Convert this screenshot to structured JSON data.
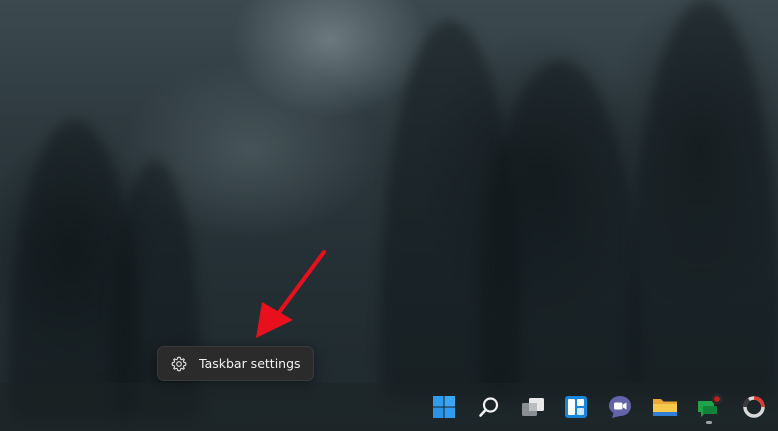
{
  "context_menu": {
    "items": [
      {
        "label": "Taskbar settings",
        "icon": "gear-icon"
      }
    ]
  },
  "taskbar": {
    "icons": [
      {
        "name": "start-button",
        "icon": "windows-logo-icon"
      },
      {
        "name": "search-button",
        "icon": "search-icon"
      },
      {
        "name": "task-view-button",
        "icon": "task-view-icon"
      },
      {
        "name": "widgets-button",
        "icon": "widgets-icon"
      },
      {
        "name": "teams-chat-button",
        "icon": "teams-chat-icon"
      },
      {
        "name": "file-explorer-button",
        "icon": "folder-icon"
      },
      {
        "name": "greenshot-app-button",
        "icon": "greenshot-icon",
        "running": true
      },
      {
        "name": "app-button",
        "icon": "ring-app-icon"
      }
    ]
  },
  "colors": {
    "arrow": "#e8101c",
    "menu_bg": "#2b2b2b",
    "windows_blue": "#2f9cf0",
    "teams_purple": "#6264a7",
    "folder_yellow": "#f7c94b",
    "greenshot_green": "#1fa34a"
  }
}
